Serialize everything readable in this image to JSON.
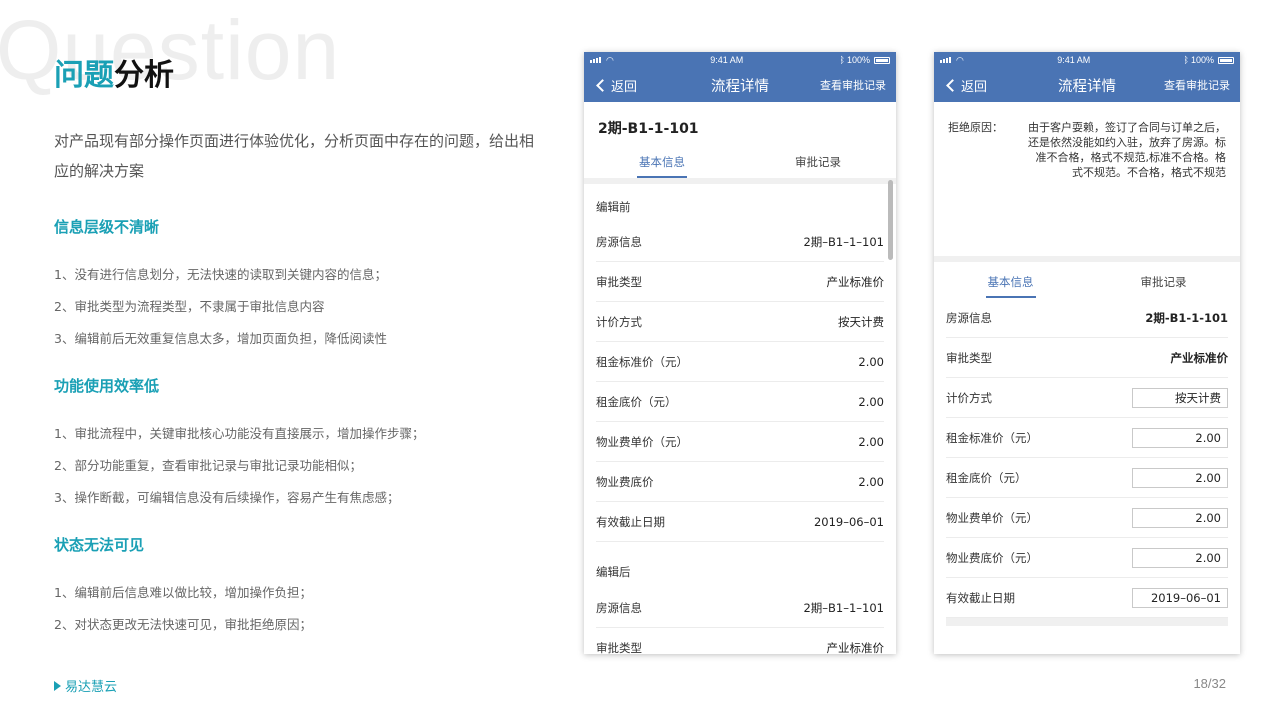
{
  "watermark": "Question",
  "title": {
    "accent": "问题",
    "rest": "分析"
  },
  "intro": "对产品现有部分操作页面进行体验优化，分析页面中存在的问题，给出相应的解决方案",
  "sections": [
    {
      "heading": "信息层级不清晰",
      "items": [
        "1、没有进行信息划分，无法快速的读取到关键内容的信息；",
        "2、审批类型为流程类型，不隶属于审批信息内容",
        "3、编辑前后无效重复信息太多，增加页面负担，降低阅读性"
      ]
    },
    {
      "heading": "功能使用效率低",
      "items": [
        "1、审批流程中，关键审批核心功能没有直接展示，增加操作步骤；",
        "2、部分功能重复，查看审批记录与审批记录功能相似；",
        "3、操作断截，可编辑信息没有后续操作，容易产生有焦虑感；"
      ]
    },
    {
      "heading": "状态无法可见",
      "items": [
        "1、编辑前后信息难以做比较，增加操作负担；",
        "2、对状态更改无法快速可见，审批拒绝原因；"
      ]
    }
  ],
  "footer": {
    "brand": "易达慧云",
    "page": "18/32"
  },
  "phone1": {
    "time": "9:41 AM",
    "battery": "100%",
    "back": "返回",
    "title": "流程详情",
    "record_link": "查看审批记录",
    "room": "2期-B1-1-101",
    "tabs": [
      "基本信息",
      "审批记录"
    ],
    "before_title": "编辑前",
    "before_rows": [
      {
        "k": "房源信息",
        "v": "2期–B1–1–101"
      },
      {
        "k": "审批类型",
        "v": "产业标准价"
      },
      {
        "k": "计价方式",
        "v": "按天计费"
      },
      {
        "k": "租金标准价（元）",
        "v": "2.00"
      },
      {
        "k": "租金底价（元）",
        "v": "2.00"
      },
      {
        "k": "物业费单价（元）",
        "v": "2.00"
      },
      {
        "k": "物业费底价",
        "v": "2.00"
      },
      {
        "k": "有效截止日期",
        "v": "2019–06–01"
      }
    ],
    "after_title": "编辑后",
    "after_rows": [
      {
        "k": "房源信息",
        "v": "2期–B1–1–101"
      },
      {
        "k": "审批类型",
        "v": "产业标准价"
      }
    ]
  },
  "phone2": {
    "time": "9:41 AM",
    "battery": "100%",
    "back": "返回",
    "title": "流程详情",
    "record_link": "查看审批记录",
    "reason_label": "拒绝原因：",
    "reason_text": "由于客户耍赖，签订了合同与订单之后，还是依然没能如约入驻，放弃了房源。标准不合格，格式不规范,标准不合格。格式不规范。不合格，格式不规范",
    "tabs": [
      "基本信息",
      "审批记录"
    ],
    "rows": [
      {
        "k": "房源信息",
        "v": "2期-B1-1-101"
      },
      {
        "k": "审批类型",
        "v": "产业标准价"
      },
      {
        "k": "计价方式",
        "v": "按天计费"
      },
      {
        "k": "租金标准价（元）",
        "v": "2.00"
      },
      {
        "k": "租金底价（元）",
        "v": "2.00"
      },
      {
        "k": "物业费单价（元）",
        "v": "2.00"
      },
      {
        "k": "物业费底价（元）",
        "v": "2.00"
      },
      {
        "k": "有效截止日期",
        "v": "2019–06–01"
      }
    ]
  }
}
